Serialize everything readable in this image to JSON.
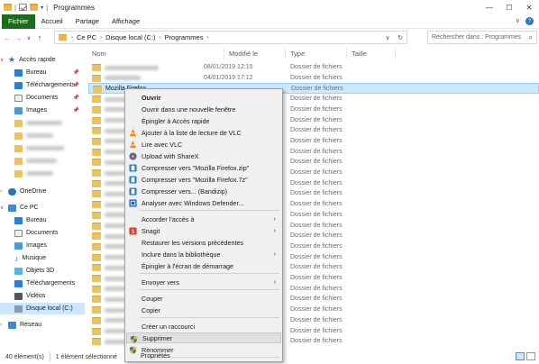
{
  "window": {
    "title": "Programmes",
    "minimize": "—",
    "maximize": "☐",
    "close": "✕"
  },
  "ribbon": {
    "tabs": [
      "Fichier",
      "Accueil",
      "Partage",
      "Affichage"
    ],
    "expand": "∨",
    "help": "?"
  },
  "address": {
    "crumbs": [
      "Ce PC",
      "Disque local (C:)",
      "Programmes"
    ],
    "search_placeholder": "Rechercher dans : Programmes"
  },
  "columns": {
    "name": "Nom",
    "modified": "Modifié le",
    "type": "Type",
    "size": "Taille"
  },
  "rows": [
    {
      "date": "08/01/2019 12:15",
      "type": "Dossier de fichiers"
    },
    {
      "date": "04/01/2019 17:12",
      "type": "Dossier de fichiers"
    },
    {
      "name": "Mozilla Firefox",
      "date": "",
      "type": "Dossier de fichiers",
      "selected": true
    },
    {
      "date": "",
      "type": "Dossier de fichiers"
    },
    {
      "date": "",
      "type": "Dossier de fichiers"
    },
    {
      "date": "",
      "type": "Dossier de fichiers"
    },
    {
      "date": "",
      "type": "Dossier de fichiers"
    },
    {
      "date": "",
      "type": "Dossier de fichiers"
    },
    {
      "date": "",
      "type": "Dossier de fichiers"
    },
    {
      "date": "",
      "type": "Dossier de fichiers"
    },
    {
      "date": "",
      "type": "Dossier de fichiers"
    },
    {
      "date": "",
      "type": "Dossier de fichiers"
    },
    {
      "date": "",
      "type": "Dossier de fichiers"
    },
    {
      "date": "",
      "type": "Dossier de fichiers"
    },
    {
      "date": "",
      "type": "Dossier de fichiers"
    },
    {
      "date": "",
      "type": "Dossier de fichiers"
    },
    {
      "date": "",
      "type": "Dossier de fichiers"
    },
    {
      "date": "",
      "type": "Dossier de fichiers"
    },
    {
      "date": "",
      "type": "Dossier de fichiers"
    },
    {
      "date": "",
      "type": "Dossier de fichiers"
    },
    {
      "date": "",
      "type": "Dossier de fichiers"
    },
    {
      "date": "",
      "type": "Dossier de fichiers"
    },
    {
      "date": "",
      "type": "Dossier de fichiers"
    },
    {
      "date": "",
      "type": "Dossier de fichiers"
    },
    {
      "date": "",
      "type": "Dossier de fichiers"
    },
    {
      "date": "",
      "type": "Dossier de fichiers"
    },
    {
      "date": "",
      "type": "Dossier de fichiers"
    }
  ],
  "nav": {
    "quick_access": "Accès rapide",
    "quick_items": [
      "Bureau",
      "Téléchargements",
      "Documents",
      "Images"
    ],
    "onedrive": "OneDrive",
    "this_pc": "Ce PC",
    "pc_items": [
      "Bureau",
      "Documents",
      "Images",
      "Musique",
      "Objets 3D",
      "Téléchargements",
      "Vidéos",
      "Disque local (C:)"
    ],
    "network": "Réseau"
  },
  "context_menu": {
    "open": "Ouvrir",
    "open_new_window": "Ouvrir dans une nouvelle fenêtre",
    "pin_quick": "Épingler à Accès rapide",
    "vlc_add": "Ajouter à la liste de lecture de VLC",
    "vlc_play": "Lire avec VLC",
    "sharex": "Upload with ShareX",
    "zip": "Compresser vers \"Mozilla Firefox.zip\"",
    "7z": "Compresser vers \"Mozilla Firefox.7z\"",
    "bandizip": "Compresser vers... (Bandizip)",
    "defender": "Analyser avec Windows Defender...",
    "give_access": "Accorder l'accès à",
    "snagit": "Snagit",
    "restore": "Restaurer les versions précédentes",
    "include_lib": "Inclure dans la bibliothèque",
    "pin_start": "Épingler à l'écran de démarrage",
    "send_to": "Envoyer vers",
    "cut": "Couper",
    "copy": "Copier",
    "shortcut": "Créer un raccourci",
    "delete": "Supprimer",
    "rename": "Renommer",
    "properties": "Propriétés"
  },
  "status": {
    "count": "40 élément(s)",
    "selected": "1 élément sélectionné"
  },
  "colors": {
    "file_tab": "#1a6b1a",
    "selection": "#cce8ff",
    "folder": "#e8c264"
  }
}
